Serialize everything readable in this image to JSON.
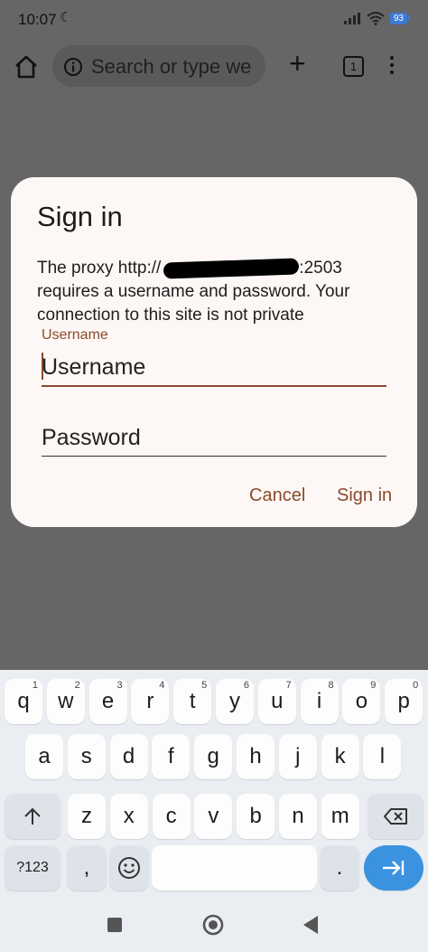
{
  "status_bar": {
    "time": "10:07",
    "battery": "93"
  },
  "browser": {
    "omnibox_placeholder": "Search or type we",
    "tab_count": "1"
  },
  "dialog": {
    "title": "Sign in",
    "message_prefix": "The proxy http://",
    "message_port": ":2503",
    "message_rest": "requires a username and password. Your connection to this site is not private",
    "username_label": "Username",
    "username_placeholder": "Username",
    "password_placeholder": "Password",
    "cancel_label": "Cancel",
    "signin_label": "Sign in"
  },
  "keyboard": {
    "row1": [
      [
        "q",
        "1"
      ],
      [
        "w",
        "2"
      ],
      [
        "e",
        "3"
      ],
      [
        "r",
        "4"
      ],
      [
        "t",
        "5"
      ],
      [
        "y",
        "6"
      ],
      [
        "u",
        "7"
      ],
      [
        "i",
        "8"
      ],
      [
        "o",
        "9"
      ],
      [
        "p",
        "0"
      ]
    ],
    "row2": [
      "a",
      "s",
      "d",
      "f",
      "g",
      "h",
      "j",
      "k",
      "l"
    ],
    "row3": [
      "z",
      "x",
      "c",
      "v",
      "b",
      "n",
      "m"
    ],
    "symbols_label": "?123",
    "comma": ",",
    "period": "."
  },
  "colors": {
    "accent": "#8b4a2c",
    "enter_key": "#3b93e0",
    "scrim": "#666666"
  }
}
